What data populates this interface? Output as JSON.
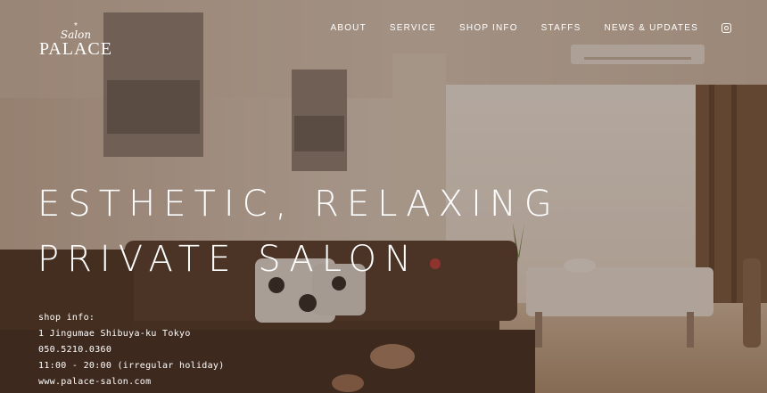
{
  "logo": {
    "mark": "*",
    "script": "Salon",
    "name": "PALACE"
  },
  "nav": {
    "items": [
      "ABOUT",
      "SERVICE",
      "SHOP INFO",
      "STAFFS",
      "NEWS & UPDATES"
    ],
    "instagram_icon": "instagram-icon"
  },
  "hero": {
    "headline_line1": "ESTHETIC, RELAXING",
    "headline_line2": "PRIVATE SALON"
  },
  "shop_info": {
    "label": "shop info:",
    "address": "1 Jingumae Shibuya-ku Tokyo",
    "phone": "050.5210.0360",
    "hours": "11:00 - 20:00 (irregular holiday)",
    "website": "www.palace-salon.com"
  },
  "colors": {
    "overlay": "#3c281c",
    "text": "#ffffff"
  }
}
